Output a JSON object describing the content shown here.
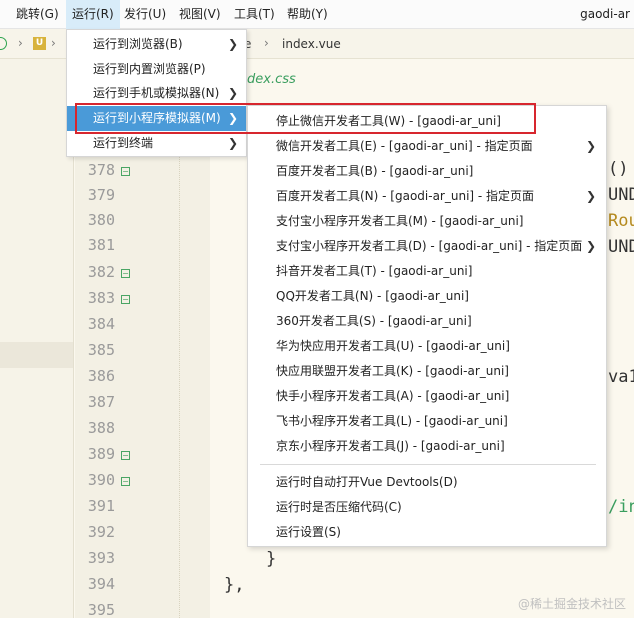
{
  "menubar": {
    "items": [
      {
        "label": "跳转(G)"
      },
      {
        "label": "运行(R)"
      },
      {
        "label": "发行(U)"
      },
      {
        "label": "视图(V)"
      },
      {
        "label": "工具(T)"
      },
      {
        "label": "帮助(Y)"
      }
    ],
    "project": "gaodi-ar"
  },
  "tabbar": {
    "badge": "U",
    "file_partial": "e",
    "file": "index.vue"
  },
  "editor": {
    "css_ref": "dex.css",
    "line_numbers": [
      "378",
      "379",
      "380",
      "381",
      "382",
      "383",
      "384",
      "385",
      "386",
      "387",
      "388",
      "389",
      "390",
      "391",
      "392",
      "393",
      "394",
      "395"
    ],
    "code_fragments": {
      "paren": "()",
      "und1": "UND",
      "rou": "Rou",
      "und2": "UND",
      "val": "va1",
      "slash": "/in",
      "brace": "}",
      "brace_comma": "},"
    }
  },
  "run_menu": {
    "items": [
      {
        "label": "运行到浏览器(B)",
        "has_submenu": true
      },
      {
        "label": "运行到内置浏览器(P)",
        "has_submenu": false
      },
      {
        "label": "运行到手机或模拟器(N)",
        "has_submenu": true
      },
      {
        "label": "运行到小程序模拟器(M)",
        "has_submenu": true,
        "selected": true
      },
      {
        "label": "运行到终端",
        "has_submenu": true
      }
    ]
  },
  "miniprogram_menu": {
    "items": [
      {
        "label": "停止微信开发者工具(W) - [gaodi-ar_uni]",
        "has_submenu": false,
        "highlighted": true
      },
      {
        "label": "微信开发者工具(E) - [gaodi-ar_uni] - 指定页面",
        "has_submenu": true
      },
      {
        "label": "百度开发者工具(B) - [gaodi-ar_uni]",
        "has_submenu": false
      },
      {
        "label": "百度开发者工具(N) - [gaodi-ar_uni] - 指定页面",
        "has_submenu": true
      },
      {
        "label": "支付宝小程序开发者工具(M) - [gaodi-ar_uni]",
        "has_submenu": false
      },
      {
        "label": "支付宝小程序开发者工具(D) - [gaodi-ar_uni] - 指定页面",
        "has_submenu": true
      },
      {
        "label": "抖音开发者工具(T) - [gaodi-ar_uni]",
        "has_submenu": false
      },
      {
        "label": "QQ开发者工具(N) - [gaodi-ar_uni]",
        "has_submenu": false
      },
      {
        "label": "360开发者工具(S) - [gaodi-ar_uni]",
        "has_submenu": false
      },
      {
        "label": "华为快应用开发者工具(U) - [gaodi-ar_uni]",
        "has_submenu": false
      },
      {
        "label": "快应用联盟开发者工具(K) - [gaodi-ar_uni]",
        "has_submenu": false
      },
      {
        "label": "快手小程序开发者工具(A) - [gaodi-ar_uni]",
        "has_submenu": false
      },
      {
        "label": "飞书小程序开发者工具(L) - [gaodi-ar_uni]",
        "has_submenu": false
      },
      {
        "label": "京东小程序开发者工具(J) - [gaodi-ar_uni]",
        "has_submenu": false
      }
    ],
    "bottom_items": [
      {
        "label": "运行时自动打开Vue Devtools(D)"
      },
      {
        "label": "运行时是否压缩代码(C)"
      },
      {
        "label": "运行设置(S)"
      }
    ]
  },
  "watermark": "@稀土掘金技术社区",
  "colors": {
    "selected_bg": "#4a9ad8",
    "highlight_border": "#d7262e",
    "editor_bg": "#fbf8ee",
    "fold_green": "#4aa564"
  }
}
